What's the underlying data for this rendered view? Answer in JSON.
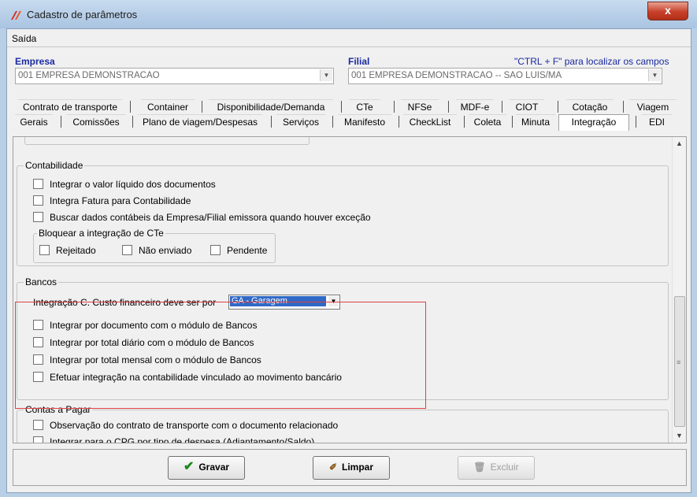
{
  "window": {
    "title": "Cadastro de parâmetros",
    "close": "x"
  },
  "menu": {
    "saida": "Saída"
  },
  "header": {
    "empresa_label": "Empresa",
    "filial_label": "Filial",
    "hint": "\"CTRL + F\" para localizar os campos",
    "empresa_value": "001 EMPRESA DEMONSTRACAO",
    "filial_value": "001 EMPRESA DEMONSTRACAO -- SAO LUIS/MA"
  },
  "tabs_top": [
    "Contrato de transporte",
    "Container",
    "Disponibilidade/Demanda",
    "CTe",
    "NFSe",
    "MDF-e",
    "CIOT",
    "Cotação",
    "Viagem"
  ],
  "tabs_bottom": [
    "Gerais",
    "Comissões",
    "Plano de viagem/Despesas",
    "Serviços",
    "Manifesto",
    "CheckList",
    "Coleta",
    "Minuta",
    "Integração",
    "EDI"
  ],
  "contabilidade": {
    "title": "Contabilidade",
    "items": [
      "Integrar o valor líquido dos documentos",
      "Integra Fatura para Contabilidade",
      "Buscar dados contábeis da Empresa/Filial emissora quando houver exceção"
    ],
    "bloquear_title": "Bloquear a integração de CTe",
    "bloquear_items": [
      "Rejeitado",
      "Não enviado",
      "Pendente"
    ]
  },
  "bancos": {
    "title": "Bancos",
    "combo_label": "Integração C. Custo financeiro deve ser por",
    "combo_value": "GA - Garagem",
    "items": [
      "Integrar por documento com o módulo de Bancos",
      "Integrar por total diário com o módulo de Bancos",
      "Integrar por total mensal com o módulo de Bancos",
      "Efetuar integração na contabilidade vinculado ao movimento bancário"
    ]
  },
  "contas_pagar": {
    "title": "Contas a Pagar",
    "items": [
      "Observação do contrato de transporte com o documento relacionado",
      "Integrar para o CPG por tipo de despesa (Adiantamento/Saldo)"
    ]
  },
  "buttons": {
    "gravar": "Gravar",
    "limpar": "Limpar",
    "excluir": "Excluir"
  },
  "colors": {
    "accent": "#1a2aa0",
    "highlight_border": "#e04040",
    "selection": "#3169c6"
  }
}
